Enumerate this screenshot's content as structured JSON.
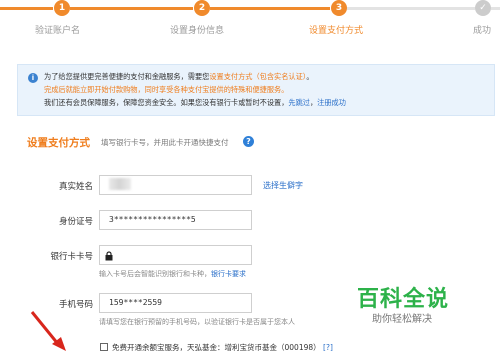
{
  "stepper": {
    "steps": [
      {
        "num": "1",
        "label": "验证账户名"
      },
      {
        "num": "2",
        "label": "设置身份信息"
      },
      {
        "num": "3",
        "label": "设置支付方式"
      },
      {
        "num": "✓",
        "label": "成功"
      }
    ]
  },
  "notice": {
    "line1_a": "为了给您提供更完善便捷的支付和金融服务，需要您",
    "line1_link": "设置支付方式（包含实名认证）",
    "line1_b": "。",
    "line2": "完成后就能立即开始付款购物，同时享受各种支付宝提供的特殊和便捷服务。",
    "line3_a": "我们还有会员保障服务，保障您资金安全。如果您没有银行卡或暂时不设置，",
    "line3_link1": "先跳过",
    "line3_sep": "，",
    "line3_link2": "注册成功"
  },
  "form": {
    "title": "设置支付方式",
    "subtitle": "填写银行卡号，并用此卡开通快捷支付",
    "name_label": "真实姓名",
    "name_link": "选择生僻字",
    "id_label": "身份证号",
    "id_value": "3****************5",
    "card_label": "银行卡卡号",
    "card_hint": "输入卡号后会智能识别银行和卡种，",
    "card_hint_link": "银行卡要求",
    "phone_label": "手机号码",
    "phone_value": "159****2559",
    "phone_hint": "请填写您在银行预留的手机号码，以验证银行卡是否属于您本人",
    "agree_text": "免费开通余额宝服务，天弘基金：增利宝货币基金（000198）",
    "agree_link": "[?]"
  },
  "watermark": {
    "main": "百科全说",
    "sub": "助你轻松解决"
  },
  "colors": {
    "accent": "#f08a2c",
    "link": "#2a6fc9",
    "notice_bg": "#eaf3fc",
    "watermark": "#2db24a"
  }
}
